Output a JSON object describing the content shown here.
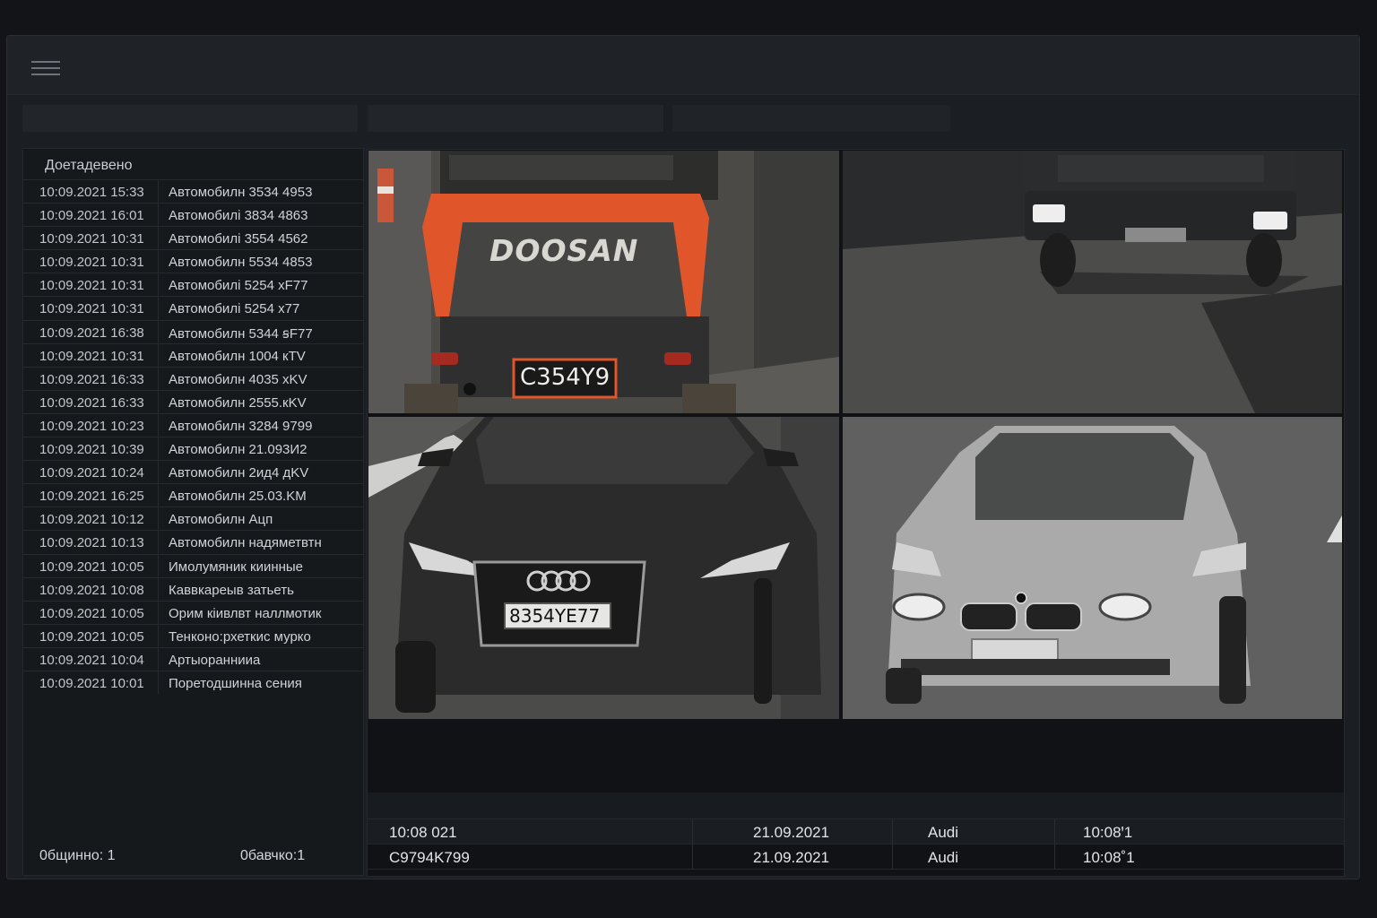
{
  "panel": {
    "header": "Доетадевено",
    "rows": [
      {
        "time": "10:09.2021 15:33",
        "desc": "Автомобилн   3534 4953"
      },
      {
        "time": "10:09.2021 16:01",
        "desc": "Автомобилі   3834 4863"
      },
      {
        "time": "10:09.2021 10:31",
        "desc": "Автомобилі   3554 4562"
      },
      {
        "time": "10:09.2021 10:31",
        "desc": "Автомобилн   5534 4853"
      },
      {
        "time": "10:09.2021 10:31",
        "desc": "Автомобилі   5254 хF77"
      },
      {
        "time": "10:09.2021 10:31",
        "desc": "Автомобилі   5254 х77"
      },
      {
        "time": "10:09.2021 16:38",
        "desc": "Автомобилн   5344 ꞩF77"
      },
      {
        "time": "10:09.2021 10:31",
        "desc": "Автомобилн   1004 кTV"
      },
      {
        "time": "10:09.2021 16:33",
        "desc": "Автомобилн   4035 хKV"
      },
      {
        "time": "10:09.2021 16:33",
        "desc": "Автомобилн   2555.кKV"
      },
      {
        "time": "10:09.2021 10:23",
        "desc": "Автомобилн   3284 9799"
      },
      {
        "time": "10:09.2021 10:39",
        "desc": "Автомобилн   21.093И2"
      },
      {
        "time": "10:09.2021 10:24",
        "desc": "Автомобилн   2ид4 дKV"
      },
      {
        "time": "10:09.2021 16:25",
        "desc": "Автомобилн   25.03.KM"
      },
      {
        "time": "10:09.2021 10:12",
        "desc": "Автомобилн   Ацп"
      },
      {
        "time": "10:09.2021 10:13",
        "desc": "Автомобилн  надяметвтн"
      },
      {
        "time": "10:09.2021 10:05",
        "desc": "Имолумяник киинные"
      },
      {
        "time": "10:09.2021 10:08",
        "desc": "Каввкареыв затьеть"
      },
      {
        "time": "10:09.2021 10:05",
        "desc": "Орим кіивлвт наллмотик"
      },
      {
        "time": "10:09.2021 10:05",
        "desc": "Тенконо:рхеткис мурко"
      },
      {
        "time": "10:09.2021 10:04",
        "desc": "Артыораннииа"
      },
      {
        "time": "10:09.2021 10:01",
        "desc": "Поретодшинна сения"
      }
    ],
    "footer_left": "0бщинно:  1",
    "footer_right": "0бавчко:1"
  },
  "cameras": {
    "cam1": {
      "brand": "DOOSAN",
      "plate": "C354Y9",
      "body_color": "#e0552a"
    },
    "cam3": {
      "plate": "8354YE77"
    }
  },
  "info_table": {
    "rows": [
      {
        "c1": "10:08 021",
        "c2": "21.09.2021",
        "c3": "Audi",
        "c4": "10:08ꞌ1"
      },
      {
        "c1": "C9794K799",
        "c2": "21.09.2021",
        "c3": "Audi",
        "c4": "10:08˚1"
      }
    ]
  }
}
